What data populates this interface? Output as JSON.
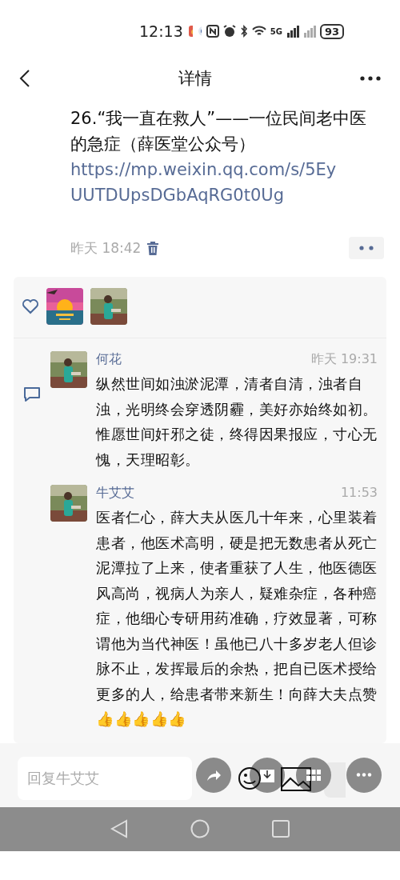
{
  "status_bar": {
    "time": "12:13",
    "network": "5G",
    "battery": "93"
  },
  "header": {
    "title": "详情"
  },
  "post": {
    "text": "26.“我一直在救人”——一位民间老中医的急症（薛医堂公众号）",
    "link": "https://mp.weixin.qq.com/s/5EyUUTDUpsDGbAqRG0t0Ug",
    "time": "昨天 18:42"
  },
  "comments": [
    {
      "name": "何花",
      "time": "昨天 19:31",
      "text": "纵然世间如浊淤泥潭，清者自清，浊者自浊，光明终会穿透阴霾，美好亦始终如初。惟愿世间奸邪之徒，终得因果报应，寸心无愧，天理昭彰。"
    },
    {
      "name": "牛艾艾",
      "time": "11:53",
      "text": "医者仁心，薛大夫从医几十年来，心里装着患者，他医术高明，硬是把无数患者从死亡泥潭拉了上来，使者重获了人生，他医德医风高尚，视病人为亲人，疑难杂症，各种癌症，他细心专研用药准确，疗效显著，可称谓他为当代神医！虽他已八十多岁老人但诊脉不止，发挥最后的余热，把自已医术授给更多的人，给患者带来新生！向薛大夫点赞👍👍👍👍👍"
    }
  ],
  "reply": {
    "placeholder": "回复牛艾艾"
  }
}
